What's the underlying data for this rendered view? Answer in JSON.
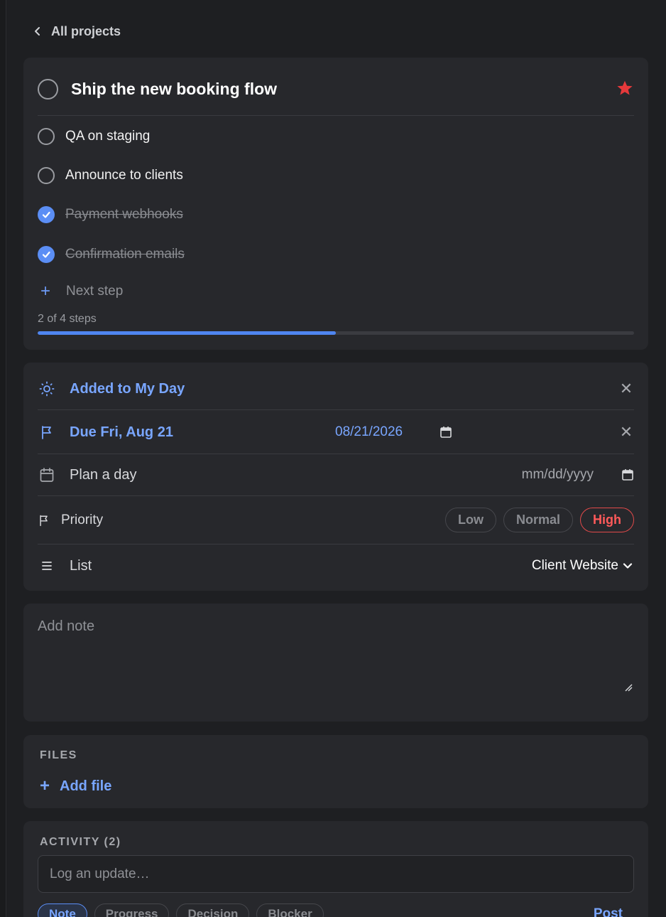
{
  "nav": {
    "back_label": "All projects"
  },
  "task": {
    "title": "Ship the new booking flow",
    "starred": true,
    "star_color": "#e5393b"
  },
  "steps": [
    {
      "label": "QA on staging",
      "done": false
    },
    {
      "label": "Announce to clients",
      "done": false
    },
    {
      "label": "Payment webhooks",
      "done": true
    },
    {
      "label": "Confirmation emails",
      "done": true
    }
  ],
  "add_step_placeholder": "Next step",
  "progress": {
    "text": "2 of 4 steps",
    "fraction": 0.5
  },
  "details": {
    "my_day_label": "Added to My Day",
    "due_label": "Due Fri, Aug 21",
    "due_date_value": "08/21/2026",
    "plan_label": "Plan a day",
    "plan_placeholder": "mm/dd/yyyy",
    "priority_label": "Priority",
    "priority_options": [
      "Low",
      "Normal",
      "High"
    ],
    "priority_selected": "High",
    "list_label": "List",
    "list_value": "Client Website"
  },
  "note": {
    "placeholder": "Add note"
  },
  "files": {
    "heading": "FILES",
    "add_label": "Add file"
  },
  "activity": {
    "heading": "ACTIVITY (2)",
    "input_placeholder": "Log an update…",
    "tags": [
      "Note",
      "Progress",
      "Decision",
      "Blocker"
    ],
    "tag_selected": "Note",
    "post_label": "Post"
  },
  "colors": {
    "accent": "#79a6ff",
    "high_priority": "#ff5a5a",
    "background": "#1e1f22",
    "card": "#27282c"
  }
}
